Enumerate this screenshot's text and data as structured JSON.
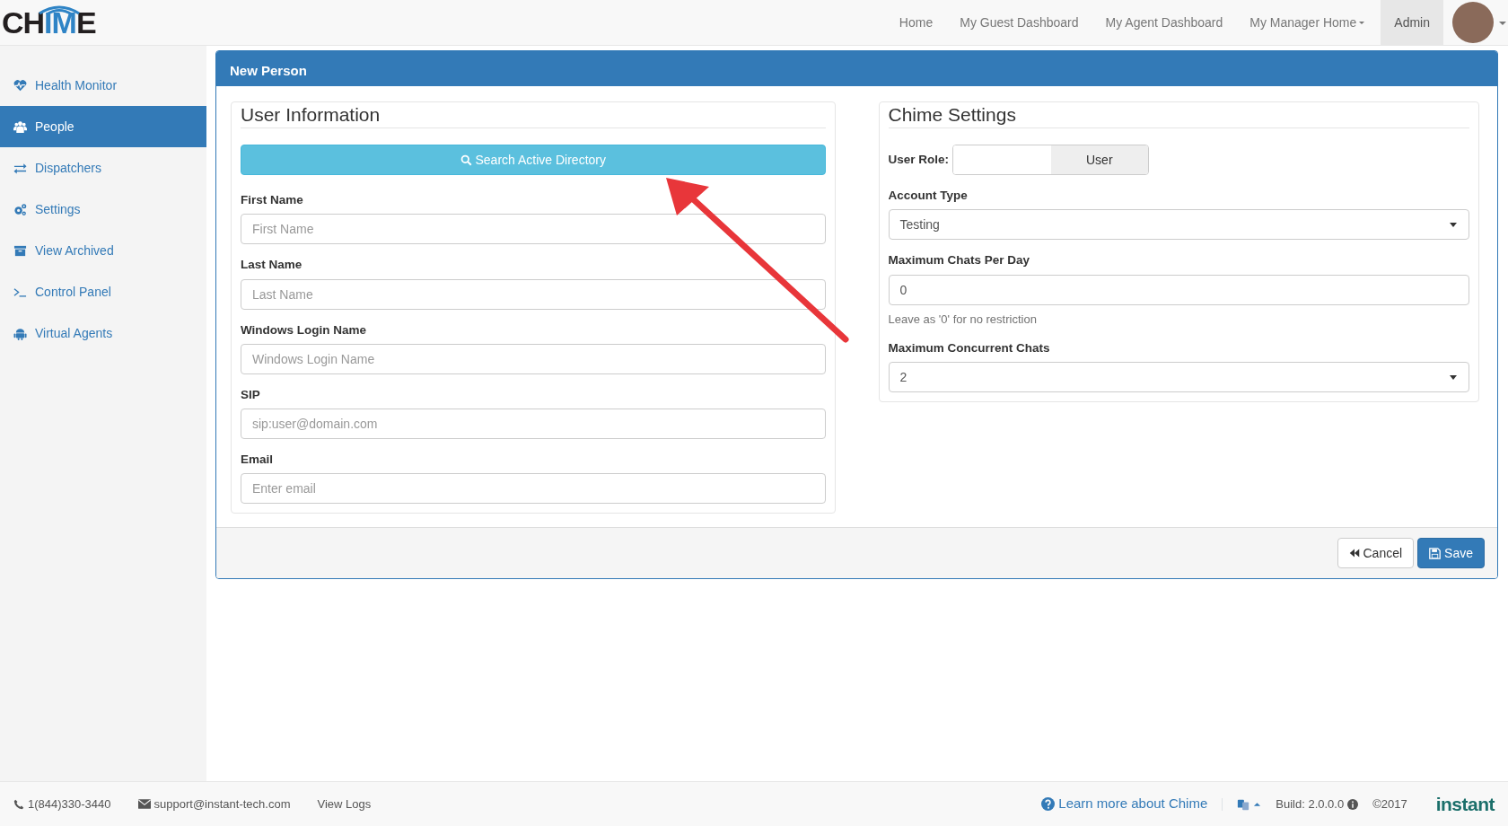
{
  "logo": {
    "text": "CHIME"
  },
  "top_nav": [
    {
      "label": "Home",
      "selected": false,
      "dropdown": false
    },
    {
      "label": "My Guest Dashboard",
      "selected": false,
      "dropdown": false
    },
    {
      "label": "My Agent Dashboard",
      "selected": false,
      "dropdown": false
    },
    {
      "label": "My Manager Home",
      "selected": false,
      "dropdown": true
    },
    {
      "label": "Admin",
      "selected": true,
      "dropdown": false
    }
  ],
  "sidebar": {
    "items": [
      {
        "label": "Health Monitor",
        "kind": "heart",
        "selected": false
      },
      {
        "label": "People",
        "kind": "people",
        "selected": true
      },
      {
        "label": "Dispatchers",
        "kind": "arrows",
        "selected": false
      },
      {
        "label": "Settings",
        "kind": "gears",
        "selected": false
      },
      {
        "label": "View Archived",
        "kind": "archive",
        "selected": false
      },
      {
        "label": "Control Panel",
        "kind": "terminal",
        "selected": false
      },
      {
        "label": "Virtual Agents",
        "kind": "robot",
        "selected": false
      }
    ]
  },
  "panel": {
    "title": "New Person",
    "user_information": {
      "legend": "User Information",
      "search_button": "Search Active Directory",
      "fields": [
        {
          "label": "First Name",
          "placeholder": "First Name"
        },
        {
          "label": "Last Name",
          "placeholder": "Last Name"
        },
        {
          "label": "Windows Login Name",
          "placeholder": "Windows Login Name"
        },
        {
          "label": "SIP",
          "placeholder": "sip:user@domain.com"
        },
        {
          "label": "Email",
          "placeholder": "Enter email"
        }
      ]
    },
    "chime_settings": {
      "legend": "Chime Settings",
      "user_role": {
        "label": "User Role:",
        "value": "User"
      },
      "fields": [
        {
          "kind": "select",
          "label": "Account Type",
          "value": "Testing"
        },
        {
          "kind": "input",
          "label": "Maximum Chats Per Day",
          "value": "0",
          "help": "Leave as '0' for no restriction"
        },
        {
          "kind": "select",
          "label": "Maximum Concurrent Chats",
          "value": "2"
        }
      ]
    },
    "buttons": [
      {
        "kind": "cancel",
        "label": "Cancel"
      },
      {
        "kind": "save",
        "label": "Save"
      }
    ]
  },
  "footer": {
    "phone": "1(844)330-3440",
    "email": "support@instant-tech.com",
    "view_logs": "View Logs",
    "learn_more": "Learn more about Chime",
    "build": "Build: 2.0.0.0",
    "copyright": "©2017",
    "brand": "instant"
  }
}
